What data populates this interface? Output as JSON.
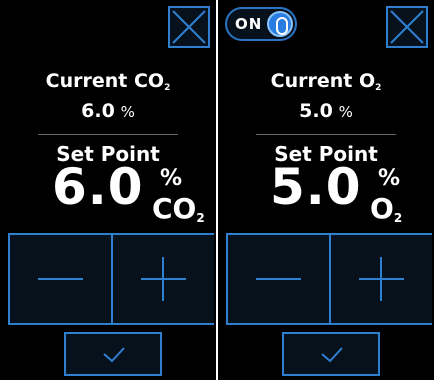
{
  "left_panel": {
    "current_label": "Current CO",
    "current_label_sub": "2",
    "current_value": "6.0",
    "current_unit": "%",
    "setpoint_label": "Set Point",
    "setpoint_value": "6.0",
    "setpoint_unit_pct": "%",
    "setpoint_unit_gas": "CO",
    "setpoint_unit_gas_sub": "2",
    "close_icon": "close-x-icon",
    "minus_icon": "minus-icon",
    "plus_icon": "plus-icon",
    "confirm_icon": "checkmark-icon"
  },
  "right_panel": {
    "toggle_label": "ON",
    "toggle_state": "on",
    "current_label": "Current O",
    "current_label_sub": "2",
    "current_value": "5.0",
    "current_unit": "%",
    "setpoint_label": "Set Point",
    "setpoint_value": "5.0",
    "setpoint_unit_pct": "%",
    "setpoint_unit_gas": "O",
    "setpoint_unit_gas_sub": "2",
    "close_icon": "close-x-icon",
    "minus_icon": "minus-icon",
    "plus_icon": "plus-icon",
    "confirm_icon": "checkmark-icon"
  },
  "colors": {
    "background": "#000000",
    "accent_border": "#2f7fd0",
    "button_fill": "#06111c",
    "toggle_knob": "#2a7de0",
    "text": "#ffffff"
  }
}
